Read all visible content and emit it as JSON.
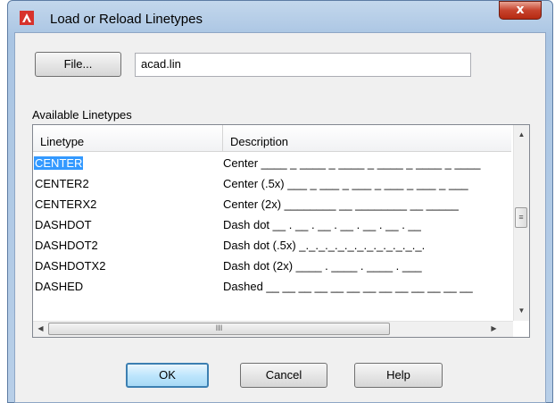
{
  "window": {
    "title": "Load or Reload Linetypes",
    "close_label": "x"
  },
  "file": {
    "button_label": "File...",
    "path_value": "acad.lin"
  },
  "section_label": "Available Linetypes",
  "list": {
    "columns": [
      "Linetype",
      "Description"
    ],
    "rows": [
      {
        "name": "CENTER",
        "description": "Center ____ _ ____ _ ____ _ ____ _ ____ _ ____",
        "selected": true
      },
      {
        "name": "CENTER2",
        "description": "Center (.5x) ___ _ ___ _ ___ _ ___ _ ___ _ ___"
      },
      {
        "name": "CENTERX2",
        "description": "Center (2x) ________  __  ________  __  _____"
      },
      {
        "name": "DASHDOT",
        "description": "Dash dot __ . __ . __ . __ . __ . __ . __"
      },
      {
        "name": "DASHDOT2",
        "description": "Dash dot (.5x) _._._._._._._._._._._._._."
      },
      {
        "name": "DASHDOTX2",
        "description": "Dash dot (2x) ____  .  ____  .  ____  .  ___"
      },
      {
        "name": "DASHED",
        "description": "Dashed __ __ __ __ __ __ __ __ __ __ __ __ __"
      }
    ]
  },
  "scrollbars": {
    "up_icon": "▲",
    "down_icon": "▼",
    "left_icon": "◀",
    "right_icon": "▶",
    "v_grip": "≡",
    "h_grip": "III"
  },
  "buttons": {
    "ok": "OK",
    "cancel": "Cancel",
    "help": "Help"
  },
  "colors": {
    "selection": "#3399ff",
    "close_button": "#c7432d",
    "frame": "#b8cfe8"
  }
}
